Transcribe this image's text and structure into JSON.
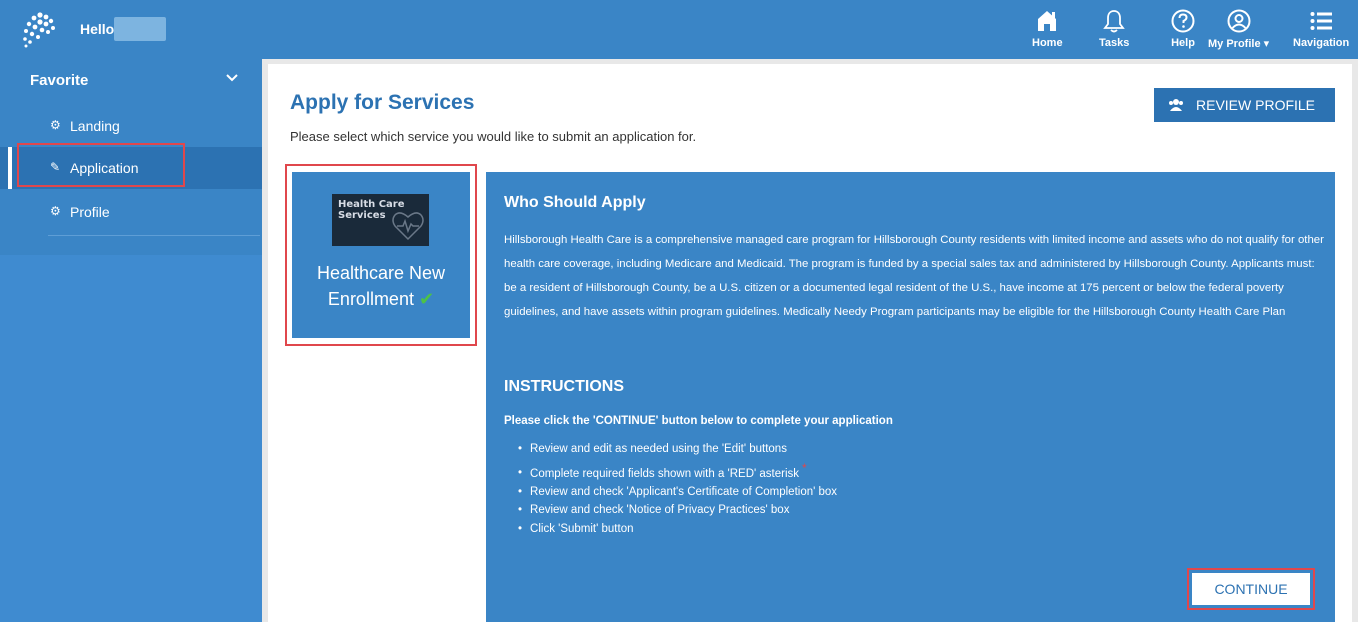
{
  "header": {
    "hello": "Hello",
    "nav": [
      {
        "label": "Home",
        "icon": "home-icon"
      },
      {
        "label": "Tasks",
        "icon": "bell-icon"
      },
      {
        "label": "Help",
        "icon": "help-icon"
      },
      {
        "label": "My Profile ▾",
        "icon": "profile-icon"
      },
      {
        "label": "Navigation",
        "icon": "menu-icon"
      }
    ]
  },
  "sidebar": {
    "section": "Favorite",
    "items": [
      {
        "label": "Landing",
        "icon": "gear-icon"
      },
      {
        "label": "Application",
        "icon": "document-edit-icon"
      },
      {
        "label": "Profile",
        "icon": "gear-icon"
      }
    ]
  },
  "main": {
    "title": "Apply for Services",
    "subtitle": "Please select which service you would like to submit an application for.",
    "review_button": "REVIEW PROFILE",
    "card": {
      "logo_text_1": "Health Care",
      "logo_text_2": "Services",
      "title_line1": "Healthcare New",
      "title_line2": "Enrollment",
      "check": "✔"
    },
    "info": {
      "who_title": "Who Should Apply",
      "who_text": "Hillsborough Health Care is a comprehensive managed care program for Hillsborough County residents with limited income and assets who do not qualify for other health care coverage, including Medicare and Medicaid. The program is funded by a special sales tax and administered by Hillsborough County. Applicants must: be a resident of Hillsborough County, be a U.S. citizen or a documented legal resident of the U.S., have income at 175 percent or below the federal poverty guidelines, and have assets within program guidelines. Medically Needy Program participants may be eligible for the Hillsborough County Health Care Plan",
      "instructions_title": "INSTRUCTIONS",
      "instructions_head": "Please click the 'CONTINUE' button below to complete your application",
      "steps": [
        "Review and edit as needed using the 'Edit' buttons",
        "Complete required fields shown with a 'RED' asterisk",
        "Review and check 'Applicant's Certificate of Completion' box",
        "Review and check 'Notice of Privacy Practices' box",
        "Click 'Submit' button"
      ],
      "asterisk": "*",
      "continue_button": "CONTINUE"
    }
  },
  "colors": {
    "primary": "#3a85c6",
    "dark_primary": "#2c72b2",
    "highlight": "#e0474c",
    "check": "#4dc247"
  }
}
